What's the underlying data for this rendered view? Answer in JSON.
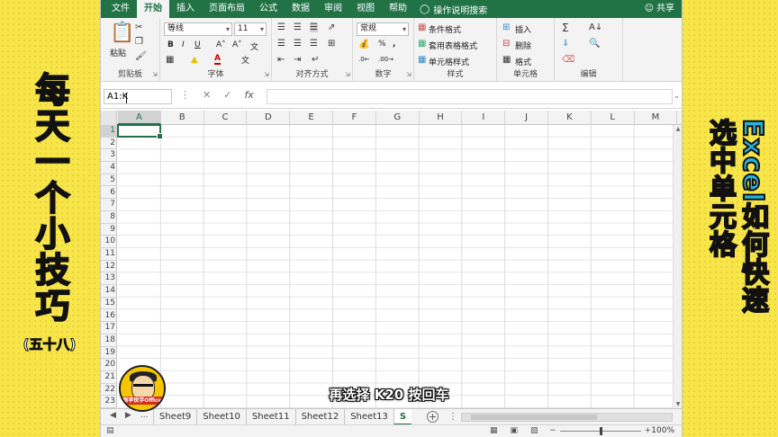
{
  "slogan": {
    "main": "每天一个小技巧",
    "sub": "(五十八)"
  },
  "title": {
    "line1": "Excel如何快速",
    "line2": "选中单元格"
  },
  "ribbon": {
    "tabs": [
      "文件",
      "开始",
      "插入",
      "页面布局",
      "公式",
      "数据",
      "审阅",
      "视图",
      "帮助"
    ],
    "active_tab": "开始",
    "tell_me": "操作说明搜索",
    "share": "共享",
    "groups": {
      "clipboard": {
        "label": "剪贴板",
        "paste": "粘贴"
      },
      "font": {
        "label": "字体",
        "font_name": "等线",
        "font_size": "11"
      },
      "alignment": {
        "label": "对齐方式"
      },
      "number": {
        "label": "数字",
        "format": "常规"
      },
      "styles": {
        "label": "样式",
        "conditional": "条件格式",
        "table": "套用表格格式",
        "cell_styles": "单元格样式"
      },
      "cells": {
        "label": "单元格",
        "insert": "插入",
        "delete": "删除",
        "format": "格式"
      },
      "editing": {
        "label": "编辑"
      }
    }
  },
  "formula_bar": {
    "name_box": "A1:K",
    "fx": "fx"
  },
  "grid": {
    "columns": [
      "A",
      "B",
      "C",
      "D",
      "E",
      "F",
      "G",
      "H",
      "I",
      "J",
      "K",
      "L",
      "M"
    ],
    "selected_column": "A",
    "rows": [
      "1",
      "2",
      "3",
      "4",
      "5",
      "6",
      "7",
      "8",
      "9",
      "10",
      "11",
      "12",
      "13",
      "14",
      "15",
      "16",
      "17",
      "18",
      "19",
      "20",
      "21",
      "22",
      "23"
    ],
    "selected_row": "1"
  },
  "sheet_tabs": {
    "ellipsis": "...",
    "tabs": [
      "Sheet9",
      "Sheet10",
      "Sheet11",
      "Sheet12",
      "Sheet13",
      "S"
    ],
    "active": "S"
  },
  "status_bar": {
    "zoom": "100%"
  },
  "caption": "再选择 K20 按回车",
  "avatar_tag": "跟李锐学Office"
}
